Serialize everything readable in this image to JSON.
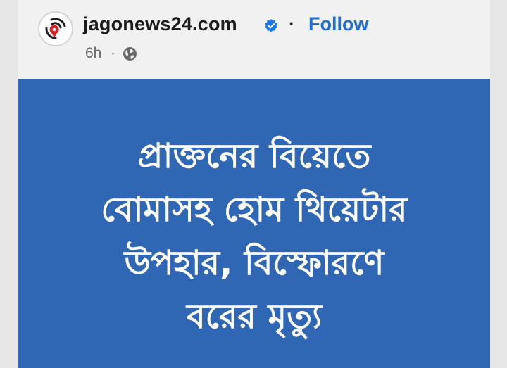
{
  "post": {
    "page_name": "jagonews24.com",
    "follow_label": "Follow",
    "separator": "·",
    "time": "6h",
    "meta_separator": "·",
    "audience_icon": "globe-icon",
    "verified_icon": "verified-badge-icon",
    "image": {
      "background_color": "#2f67b5",
      "headline_lines": [
        "প্রাক্তনের বিয়েতে",
        "বোমাসহ হোম থিয়েটার",
        "উপহার, বিস্ফোরণে",
        "বরের মৃত্যু"
      ]
    }
  },
  "colors": {
    "follow": "#1f6fd1",
    "verified": "#1877f2",
    "page_background": "#e6e6e6",
    "card_background": "#f1f1f1"
  }
}
